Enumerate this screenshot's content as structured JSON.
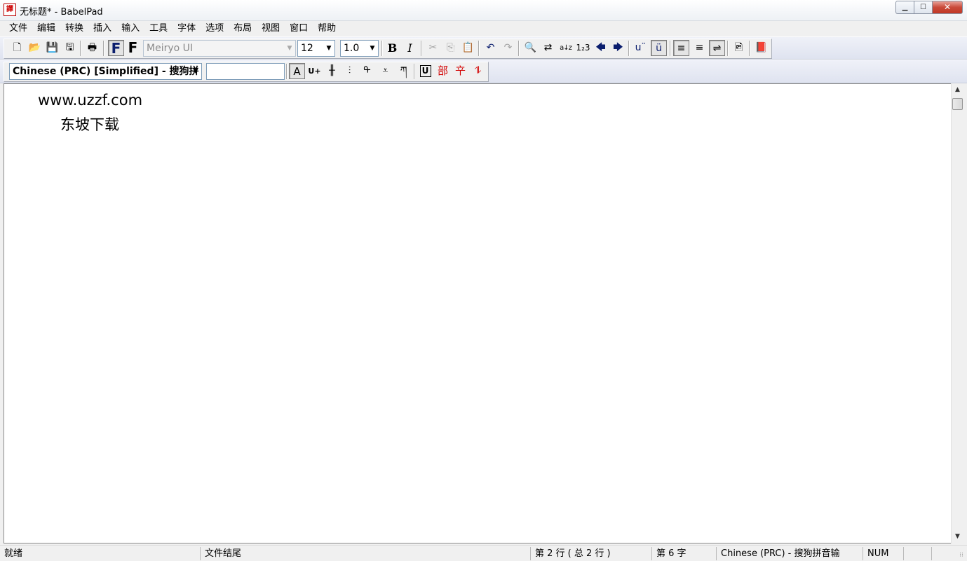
{
  "window": {
    "title": "无标题* - BabelPad",
    "icon": "babelpad-icon",
    "icon_glyph": "譯",
    "minimize_glyph": "▁",
    "maximize_glyph": "☐",
    "close_glyph": "✕"
  },
  "menu": [
    "文件",
    "编辑",
    "转换",
    "插入",
    "输入",
    "工具",
    "字体",
    "选项",
    "布局",
    "视图",
    "窗口",
    "帮助"
  ],
  "toolbar": {
    "new": "🗋",
    "open": "📂",
    "save": "💾",
    "save_all": "🖫",
    "print": "🖶",
    "font_fixed": "F",
    "font_auto": "F",
    "font_name": "Meiryo UI",
    "font_size": "12",
    "line_spacing": "1.0",
    "bold": "B",
    "italic": "I",
    "cut": "✂",
    "copy": "⎘",
    "paste": "📋",
    "undo": "↶",
    "redo": "↷",
    "find": "🔍",
    "replace": "⇄",
    "sort": "a↓z",
    "number": "1₂3",
    "back": "🡄",
    "forward": "🡆",
    "combining_marks": "u¨",
    "show_diacritics": "ü",
    "align_left": "≡",
    "align_right": "≡",
    "wrap": "⇌",
    "preview": "🖻",
    "help": "📕"
  },
  "toolbar2": {
    "input_method": "Chinese (PRC) [Simplified] - 搜狗拼",
    "input_box": "",
    "char_mode": "A",
    "unicode_mode": "U+",
    "vertical_1": "╫",
    "vertical_2": "⫶",
    "mongolian": "ᠲ",
    "yi": "⩡",
    "tibetan": "ཀ",
    "unicode_box": "U",
    "radical": "部",
    "radical_stroke": "䇂",
    "reverse": "⥮"
  },
  "document": {
    "lines": [
      "www.uzzf.com",
      "东坡下载"
    ]
  },
  "scrollbar": {
    "up": "▲",
    "down": "▼"
  },
  "status": {
    "ready": "就绪",
    "file_end": "文件结尾",
    "line": "第 2 行 ( 总 2 行 )",
    "char": "第 6 字",
    "ime": "Chinese (PRC) - 搜狗拼音输",
    "num": "NUM",
    "grip": "⁝⁝"
  }
}
